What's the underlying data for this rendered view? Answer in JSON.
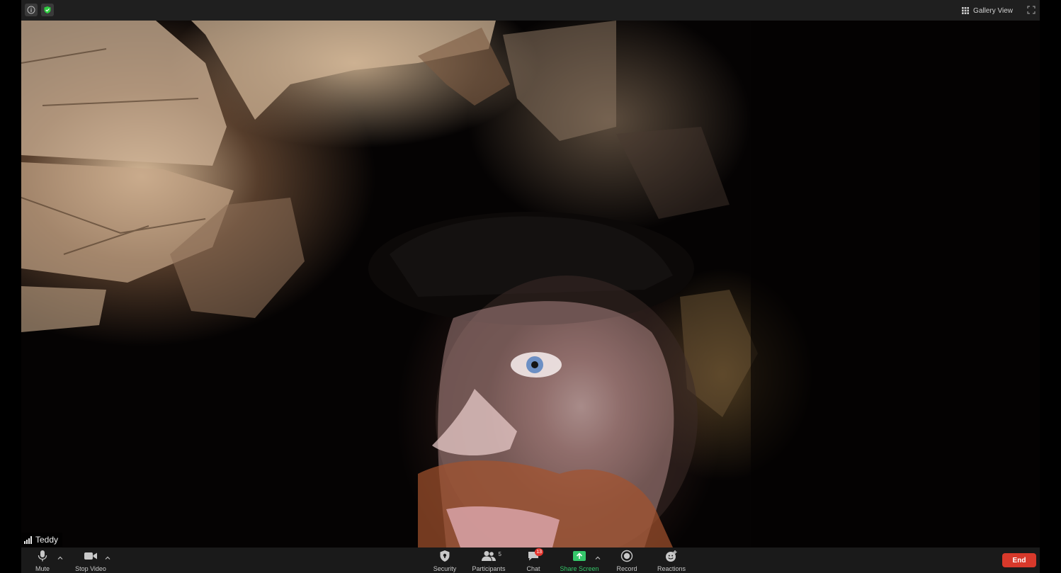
{
  "top_bar": {
    "info_icon": "info-icon",
    "security_icon": "shield-check-icon",
    "gallery_view_label": "Gallery View",
    "fullscreen_icon": "fullscreen-icon"
  },
  "video": {
    "participant_name": "Teddy",
    "signal_icon": "signal-bars-icon"
  },
  "toolbar": {
    "mute_label": "Mute",
    "stop_video_label": "Stop Video",
    "security_label": "Security",
    "participants_label": "Participants",
    "participants_count": "5",
    "chat_label": "Chat",
    "chat_badge": "13",
    "share_screen_label": "Share Screen",
    "record_label": "Record",
    "reactions_label": "Reactions",
    "end_label": "End"
  },
  "colors": {
    "toolbar_bg": "#1a1a1a",
    "share_green": "#35c76a",
    "end_red": "#d8392b",
    "badge_red": "#e5372f",
    "shield_green": "#2ecc40"
  }
}
